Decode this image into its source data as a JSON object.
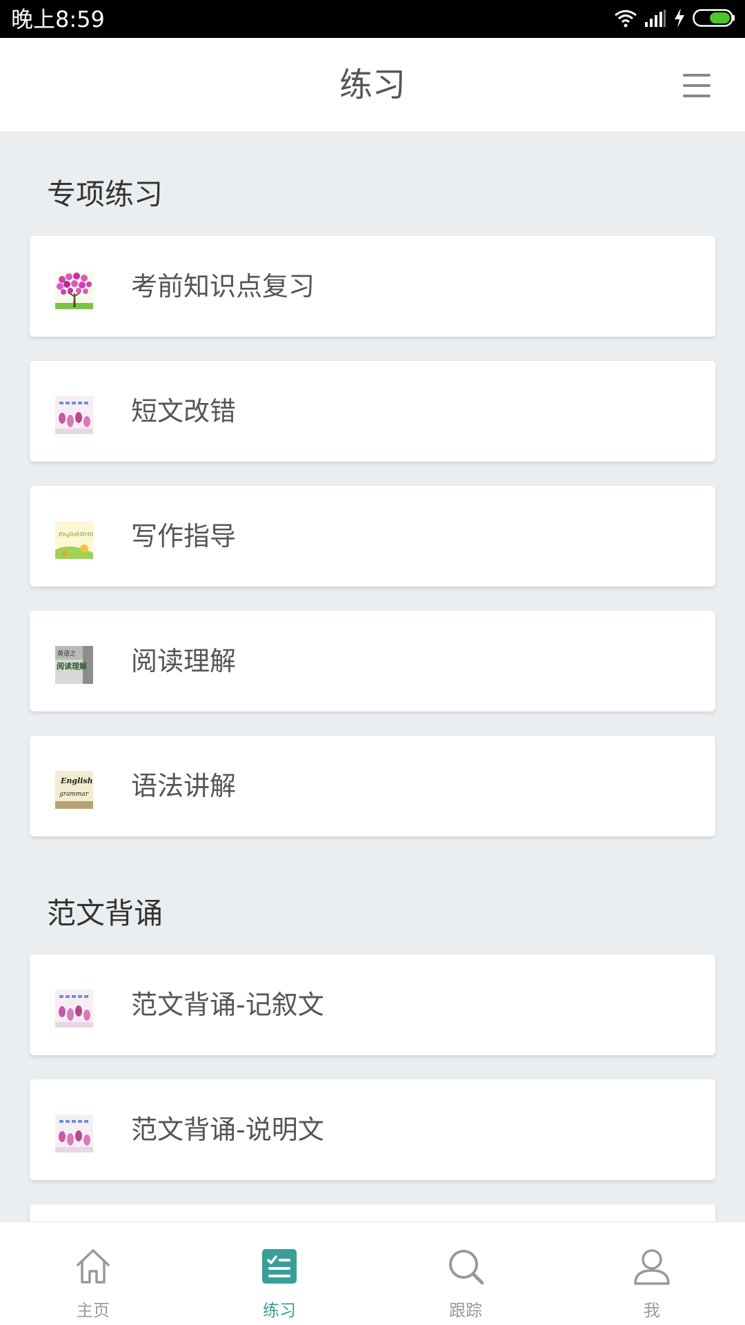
{
  "status_bar": {
    "time": "晚上8:59"
  },
  "header": {
    "title": "练习"
  },
  "sections": [
    {
      "title": "专项练习",
      "items": [
        {
          "label": "考前知识点复习",
          "thumb": "tree-thumbnail"
        },
        {
          "label": "短文改错",
          "thumb": "flower-thumbnail"
        },
        {
          "label": "写作指导",
          "thumb": "writing-thumbnail"
        },
        {
          "label": "阅读理解",
          "thumb": "reading-thumbnail"
        },
        {
          "label": "语法讲解",
          "thumb": "grammar-thumbnail"
        }
      ]
    },
    {
      "title": "范文背诵",
      "items": [
        {
          "label": "范文背诵-记叙文",
          "thumb": "flower-thumbnail"
        },
        {
          "label": "范文背诵-说明文",
          "thumb": "flower-thumbnail"
        }
      ]
    }
  ],
  "thumb_text": {
    "writing": "EnglishWriting",
    "reading_top": "英语之",
    "reading_bottom": "阅读理解",
    "grammar_top": "English",
    "grammar_bottom": "grammar"
  },
  "tabs": [
    {
      "label": "主页",
      "icon": "home-icon",
      "active": false
    },
    {
      "label": "练习",
      "icon": "practice-icon",
      "active": true
    },
    {
      "label": "跟踪",
      "icon": "search-icon",
      "active": false
    },
    {
      "label": "我",
      "icon": "user-icon",
      "active": false
    }
  ],
  "colors": {
    "accent": "#3a9e96",
    "background": "#eaeef1",
    "battery": "#4fc42b"
  }
}
